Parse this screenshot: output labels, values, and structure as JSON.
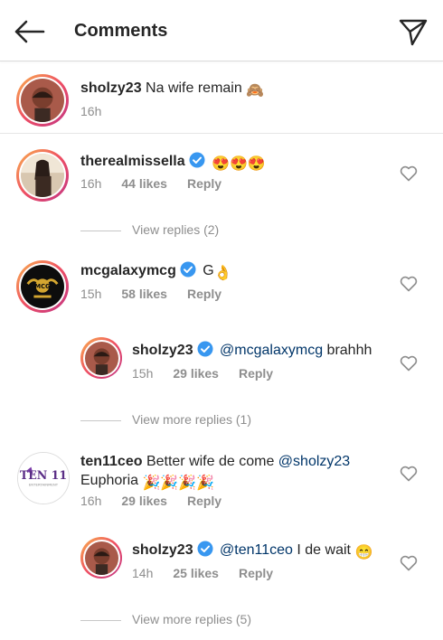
{
  "header": {
    "title": "Comments",
    "back_icon": "arrow-left-icon",
    "send_icon": "paper-plane-icon"
  },
  "caption": {
    "username": "sholzy23",
    "text": "Na wife remain",
    "emoji": "🙈",
    "time": "16h"
  },
  "comments": [
    {
      "username": "therealmissella",
      "verified": true,
      "text": "",
      "emoji": "😍😍😍",
      "time": "16h",
      "likes": "44 likes",
      "reply": "Reply",
      "view_replies": "View replies (2)"
    },
    {
      "username": "mcgalaxymcg",
      "verified": true,
      "text": "G",
      "emoji": "👌",
      "time": "15h",
      "likes": "58 likes",
      "reply": "Reply",
      "replies": [
        {
          "username": "sholzy23",
          "verified": true,
          "mention": "@mcgalaxymcg",
          "text": "brahhh",
          "time": "15h",
          "likes": "29 likes",
          "reply": "Reply"
        }
      ],
      "view_replies": "View more replies (1)"
    },
    {
      "username": "ten11ceo",
      "verified": false,
      "text_before": "Better wife de come",
      "mention": "@sholzy23",
      "text_line2": "Euphoria",
      "emoji": "🎉🎉🎉🎉",
      "time": "16h",
      "likes": "29 likes",
      "reply": "Reply",
      "avatar_text": "TEN 11",
      "avatar_subtext": "ENTERTAINMENT",
      "replies": [
        {
          "username": "sholzy23",
          "verified": true,
          "mention": "@ten11ceo",
          "text": "I de wait",
          "emoji": "😁",
          "time": "14h",
          "likes": "25 likes",
          "reply": "Reply"
        }
      ],
      "view_replies": "View more replies (5)"
    }
  ],
  "colors": {
    "text": "#262626",
    "secondary": "#8e8e8e",
    "verified": "#3897f0",
    "mention": "#003569"
  }
}
